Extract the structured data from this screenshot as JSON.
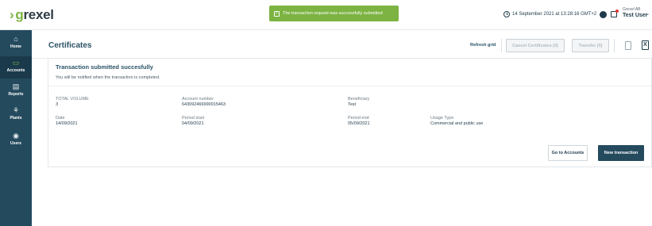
{
  "app": {
    "logo_prefix": "g",
    "logo_rest": "rexel"
  },
  "toast": {
    "message": "The transaction request was successfully submitted"
  },
  "header": {
    "datetime": "14 September 2021 at 13:28:16 GMT+2",
    "user_org": "Grexel AB",
    "user_name": "Test User"
  },
  "sidebar": {
    "items": [
      {
        "label": "Home",
        "icon": "home-icon",
        "active": false
      },
      {
        "label": "Accounts",
        "icon": "folder-icon",
        "active": true
      },
      {
        "label": "Reports",
        "icon": "document-icon",
        "active": false
      },
      {
        "label": "Plants",
        "icon": "plant-icon",
        "active": false
      },
      {
        "label": "Users",
        "icon": "user-icon",
        "active": false
      }
    ]
  },
  "page": {
    "title": "Certificates",
    "refresh_label": "Refresh grid",
    "cancel_label": "Cancel Certificates (0)",
    "transfer_label": "Transfer (0)"
  },
  "card": {
    "title": "Transaction submitted succesfully",
    "subtitle": "You will be notified when the transaction is completed.",
    "fields": {
      "total_volume_label": "TOTAL VOLUME",
      "total_volume_value": "3",
      "account_number_label": "Account number",
      "account_number_value": "643092466990015463",
      "beneficiary_label": "Beneficiary",
      "beneficiary_value": "Test",
      "date_label": "Date",
      "date_value": "14/09/2021",
      "period_start_label": "Period start",
      "period_start_value": "04/09/2021",
      "period_end_label": "Period end",
      "period_end_value": "05/09/2021",
      "usage_type_label": "Usage Type",
      "usage_type_value": "Commercial and public use"
    },
    "go_to_accounts_label": "Go to Accounts",
    "new_transaction_label": "New transaction"
  },
  "colors": {
    "brand_green": "#7cb342",
    "sidebar_bg": "#244a5e",
    "primary_button": "#244a5e"
  }
}
